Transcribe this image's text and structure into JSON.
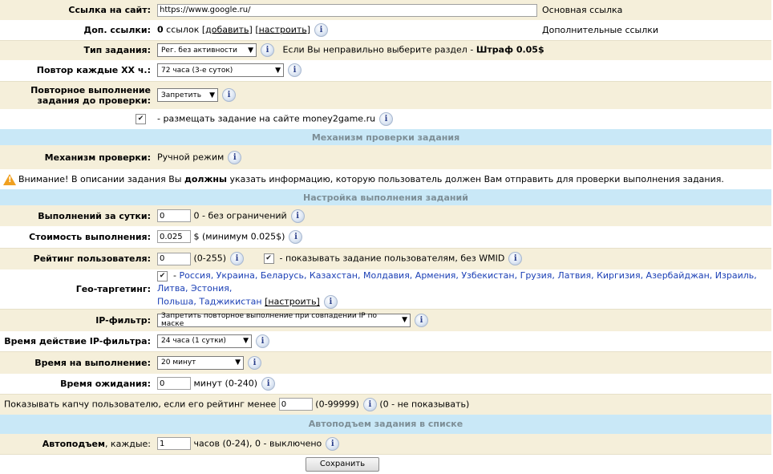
{
  "site_link": {
    "label": "Ссылка на сайт:",
    "value": "https://www.google.ru/",
    "note": "Основная ссылка"
  },
  "extra_links": {
    "label": "Доп. ссылки:",
    "count": "0",
    "count_suffix": " ссылок ",
    "add": "[добавить]",
    "configure": "[настроить]",
    "note": "Дополнительные ссылки"
  },
  "task_type": {
    "label": "Тип задания:",
    "selected": "Рег. без активности",
    "note_prefix": "Если Вы неправильно выберите раздел - ",
    "note_bold": "Штраф 0.05$"
  },
  "repeat": {
    "label": "Повтор каждые XX ч.:",
    "selected": "72 часа (3-е суток)"
  },
  "repeat_before_check": {
    "label_line1": "Повторное выполнение",
    "label_line2": "задания до проверки:",
    "selected": "Запретить"
  },
  "place_task": {
    "text": "- размещать задание на сайте money2game.ru",
    "checked": true
  },
  "section_check": "Механизм проверки задания",
  "check_mechanism": {
    "label": "Механизм проверки:",
    "value": "Ручной режим"
  },
  "warning": {
    "prefix": "Внимание! В описании задания Вы ",
    "bold": "должны",
    "suffix": " указать информацию, которую пользователь должен Вам отправить для проверки выполнения задания."
  },
  "section_settings": "Настройка выполнения заданий",
  "per_day": {
    "label": "Выполнений за сутки:",
    "value": "0",
    "note": "0 - без ограничений"
  },
  "cost": {
    "label": "Стоимость выполнения:",
    "value": "0.025",
    "note": "$ (минимум 0.025$)"
  },
  "rating": {
    "label": "Рейтинг пользователя:",
    "value": "0",
    "range": "(0-255)",
    "wmid_text": "- показывать задание пользователям, без WMID"
  },
  "geo": {
    "label": "Гео-таргетинг:",
    "prefix": "- ",
    "countries_line1": "Россия, Украина, Беларусь, Казахстан, Молдавия, Армения, Узбекистан, Грузия, Латвия, Киргизия, Азербайджан, Израиль, Литва, Эстония,",
    "countries_line2": "Польша, Таджикистан",
    "configure": "[настроить]"
  },
  "ip_filter": {
    "label": "IP-фильтр:",
    "selected": "Запретить повторное выполнение при совпадении IP по маске"
  },
  "ip_filter_time": {
    "label": "Время действие IP-фильтра:",
    "selected": "24 часа (1 сутки)"
  },
  "exec_time": {
    "label": "Время на выполнение:",
    "selected": "20 минут"
  },
  "wait_time": {
    "label": "Время ожидания:",
    "value": "0",
    "note": "минут (0-240)"
  },
  "captcha": {
    "prefix": "Показывать капчу пользователю, если его рейтинг менее",
    "value": "0",
    "range": "(0-99999)",
    "note": "(0 - не показывать)"
  },
  "section_autoraise": "Автоподъем задания в списке",
  "autoraise": {
    "label_bold": "Автоподъем",
    "label_rest": ", каждые:",
    "value": "1",
    "note": "часов (0-24), 0 - выключено"
  },
  "save_label": "Сохранить",
  "colors": {
    "cream": "#f5efda",
    "header": "#c9e8f7",
    "link": "#1a3fb5",
    "warning": "#f0a020"
  }
}
